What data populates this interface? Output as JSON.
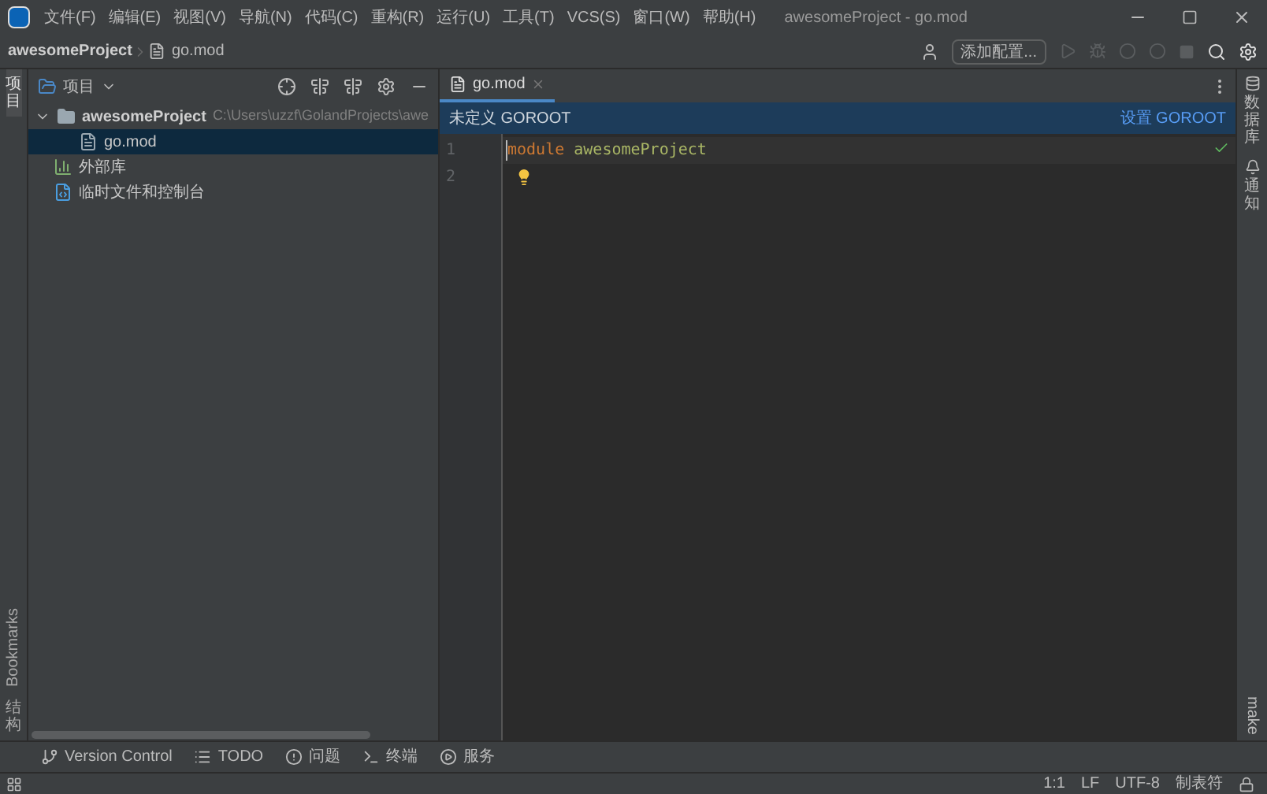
{
  "title_bar": {
    "menus": [
      "文件(F)",
      "编辑(E)",
      "视图(V)",
      "导航(N)",
      "代码(C)",
      "重构(R)",
      "运行(U)",
      "工具(T)",
      "VCS(S)",
      "窗口(W)",
      "帮助(H)"
    ],
    "title": "awesomeProject - go.mod"
  },
  "nav_bar": {
    "breadcrumbs": [
      "awesomeProject",
      "go.mod"
    ],
    "run_config_button": "添加配置..."
  },
  "left_strip": [
    {
      "label": "项目",
      "kind": "cjk",
      "selected": true
    },
    {
      "label": "Bookmarks",
      "kind": "latin",
      "selected": false
    },
    {
      "label": "结构",
      "kind": "cjk",
      "selected": false
    }
  ],
  "right_strip": [
    {
      "label": "数据库",
      "kind": "cjk"
    },
    {
      "label": "通知",
      "kind": "cjk"
    },
    {
      "label": "make",
      "kind": "latin"
    }
  ],
  "project_panel": {
    "title": "项目",
    "tree": [
      {
        "label": "awesomeProject",
        "path": "C:\\Users\\uzzf\\GolandProjects\\awe",
        "kind": "folder",
        "expanded": true,
        "selected": false,
        "children": [
          {
            "label": "go.mod",
            "kind": "file",
            "selected": true
          }
        ]
      },
      {
        "label": "外部库",
        "kind": "library",
        "selected": false
      },
      {
        "label": "临时文件和控制台",
        "kind": "scratch",
        "selected": false
      }
    ]
  },
  "editor": {
    "tabs": [
      {
        "label": "go.mod",
        "selected": true
      }
    ],
    "banner": {
      "message": "未定义 GOROOT",
      "action": "设置 GOROOT"
    },
    "lines": [
      {
        "number": "1",
        "tokens": [
          {
            "text": "module",
            "kind": "keyword"
          },
          {
            "text": " awesomeProject",
            "kind": "ident"
          }
        ]
      },
      {
        "number": "2"
      }
    ]
  },
  "bottom_tools": [
    {
      "label": "Version Control",
      "kind": "vcs"
    },
    {
      "label": "TODO",
      "kind": "todo"
    },
    {
      "label": "问题",
      "kind": "problems"
    },
    {
      "label": "终端",
      "kind": "terminal"
    },
    {
      "label": "服务",
      "kind": "services"
    }
  ],
  "status_bar": [
    "1:1",
    "LF",
    "UTF-8",
    "制表符"
  ]
}
